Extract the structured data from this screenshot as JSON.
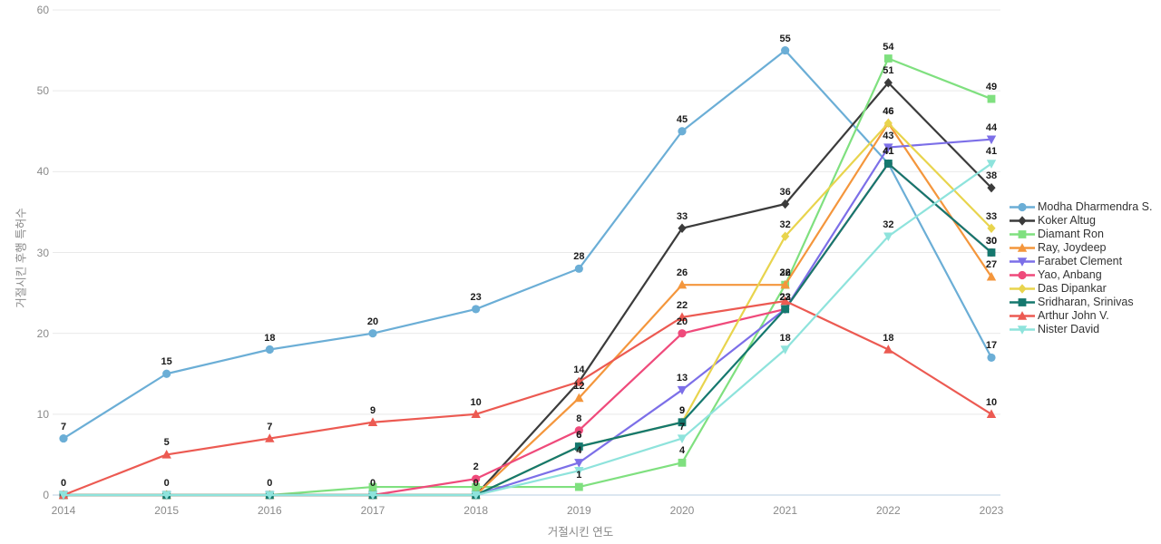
{
  "chart_data": {
    "type": "line",
    "title": "",
    "xlabel": "거절시킨 연도",
    "ylabel": "거절시킨 후행 특허수",
    "categories": [
      "2014",
      "2015",
      "2016",
      "2017",
      "2018",
      "2019",
      "2020",
      "2021",
      "2022",
      "2023"
    ],
    "ylim": [
      0,
      60
    ],
    "yticks": [
      0,
      10,
      20,
      30,
      40,
      50,
      60
    ],
    "grid": true,
    "legend_position": "right",
    "series": [
      {
        "name": "Modha Dharmendra S.",
        "color": "#6BAED6",
        "marker": "circle",
        "values": [
          7,
          15,
          18,
          20,
          23,
          28,
          45,
          55,
          41,
          17
        ]
      },
      {
        "name": "Koker Altug",
        "color": "#3B3B3B",
        "marker": "diamond",
        "values": [
          0,
          0,
          0,
          0,
          0,
          14,
          33,
          36,
          51,
          38
        ]
      },
      {
        "name": "Diamant Ron",
        "color": "#7FE07F",
        "marker": "square",
        "values": [
          0,
          0,
          0,
          1,
          1,
          1,
          4,
          26,
          54,
          49
        ]
      },
      {
        "name": "Ray, Joydeep",
        "color": "#F4963C",
        "marker": "triangle-up",
        "values": [
          0,
          0,
          0,
          0,
          0,
          12,
          26,
          26,
          46,
          27
        ]
      },
      {
        "name": "Farabet Clement",
        "color": "#7C6FE8",
        "marker": "triangle-down",
        "values": [
          0,
          0,
          0,
          0,
          0,
          4,
          13,
          23,
          43,
          44
        ]
      },
      {
        "name": "Yao, Anbang",
        "color": "#EF4A7B",
        "marker": "circle",
        "values": [
          0,
          0,
          0,
          0,
          2,
          8,
          20,
          23,
          41,
          30
        ]
      },
      {
        "name": "Das Dipankar",
        "color": "#E8D44D",
        "marker": "diamond",
        "values": [
          0,
          0,
          0,
          0,
          0,
          6,
          9,
          32,
          46,
          33
        ]
      },
      {
        "name": "Sridharan, Srinivas",
        "color": "#15786E",
        "marker": "square",
        "values": [
          0,
          0,
          0,
          0,
          0,
          6,
          9,
          23,
          41,
          30
        ]
      },
      {
        "name": "Arthur John V.",
        "color": "#EC5A52",
        "marker": "triangle-up",
        "values": [
          0,
          5,
          7,
          9,
          10,
          14,
          22,
          24,
          18,
          10
        ]
      },
      {
        "name": "Nister David",
        "color": "#8EE3DC",
        "marker": "triangle-down",
        "values": [
          0,
          0,
          0,
          0,
          0,
          3,
          7,
          18,
          32,
          41
        ]
      }
    ],
    "point_labels": [
      {
        "series": "Modha Dharmendra S.",
        "x": "2014",
        "text": "7"
      },
      {
        "series": "Modha Dharmendra S.",
        "x": "2015",
        "text": "15"
      },
      {
        "series": "Modha Dharmendra S.",
        "x": "2016",
        "text": "18"
      },
      {
        "series": "Modha Dharmendra S.",
        "x": "2017",
        "text": "20"
      },
      {
        "series": "Modha Dharmendra S.",
        "x": "2018",
        "text": "23"
      },
      {
        "series": "Modha Dharmendra S.",
        "x": "2019",
        "text": "28"
      },
      {
        "series": "Modha Dharmendra S.",
        "x": "2020",
        "text": "45"
      },
      {
        "series": "Modha Dharmendra S.",
        "x": "2021",
        "text": "55"
      },
      {
        "series": "Modha Dharmendra S.",
        "x": "2022",
        "text": "41"
      },
      {
        "series": "Modha Dharmendra S.",
        "x": "2023",
        "text": "17"
      },
      {
        "series": "Koker Altug",
        "x": "2019",
        "text": "14"
      },
      {
        "series": "Koker Altug",
        "x": "2020",
        "text": "33"
      },
      {
        "series": "Koker Altug",
        "x": "2021",
        "text": "36"
      },
      {
        "series": "Koker Altug",
        "x": "2022",
        "text": "51"
      },
      {
        "series": "Koker Altug",
        "x": "2023",
        "text": "38"
      },
      {
        "series": "Diamant Ron",
        "x": "2019",
        "text": "1"
      },
      {
        "series": "Diamant Ron",
        "x": "2020",
        "text": "4"
      },
      {
        "series": "Diamant Ron",
        "x": "2021",
        "text": "26"
      },
      {
        "series": "Diamant Ron",
        "x": "2022",
        "text": "54"
      },
      {
        "series": "Diamant Ron",
        "x": "2023",
        "text": "49"
      },
      {
        "series": "Ray, Joydeep",
        "x": "2019",
        "text": "12"
      },
      {
        "series": "Ray, Joydeep",
        "x": "2020",
        "text": "26"
      },
      {
        "series": "Ray, Joydeep",
        "x": "2021",
        "text": "32"
      },
      {
        "series": "Ray, Joydeep",
        "x": "2022",
        "text": "46"
      },
      {
        "series": "Ray, Joydeep",
        "x": "2023",
        "text": "27"
      },
      {
        "series": "Farabet Clement",
        "x": "2019",
        "text": "4"
      },
      {
        "series": "Farabet Clement",
        "x": "2020",
        "text": "13"
      },
      {
        "series": "Farabet Clement",
        "x": "2021",
        "text": "23"
      },
      {
        "series": "Farabet Clement",
        "x": "2022",
        "text": "43"
      },
      {
        "series": "Farabet Clement",
        "x": "2023",
        "text": "44"
      },
      {
        "series": "Yao, Anbang",
        "x": "2018",
        "text": "2"
      },
      {
        "series": "Yao, Anbang",
        "x": "2019",
        "text": "8"
      },
      {
        "series": "Yao, Anbang",
        "x": "2020",
        "text": "20"
      },
      {
        "series": "Yao, Anbang",
        "x": "2021",
        "text": "23"
      },
      {
        "series": "Yao, Anbang",
        "x": "2022",
        "text": "41"
      },
      {
        "series": "Yao, Anbang",
        "x": "2023",
        "text": "30"
      },
      {
        "series": "Das Dipankar",
        "x": "2019",
        "text": "6"
      },
      {
        "series": "Das Dipankar",
        "x": "2020",
        "text": "9"
      },
      {
        "series": "Das Dipankar",
        "x": "2021",
        "text": "32"
      },
      {
        "series": "Das Dipankar",
        "x": "2022",
        "text": "46"
      },
      {
        "series": "Das Dipankar",
        "x": "2023",
        "text": "33"
      },
      {
        "series": "Sridharan, Srinivas",
        "x": "2019",
        "text": "6"
      },
      {
        "series": "Sridharan, Srinivas",
        "x": "2020",
        "text": "9"
      },
      {
        "series": "Sridharan, Srinivas",
        "x": "2021",
        "text": "22"
      },
      {
        "series": "Sridharan, Srinivas",
        "x": "2022",
        "text": "41"
      },
      {
        "series": "Sridharan, Srinivas",
        "x": "2023",
        "text": "30"
      },
      {
        "series": "Arthur John V.",
        "x": "2014",
        "text": "0"
      },
      {
        "series": "Arthur John V.",
        "x": "2015",
        "text": "5"
      },
      {
        "series": "Arthur John V.",
        "x": "2016",
        "text": "7"
      },
      {
        "series": "Arthur John V.",
        "x": "2017",
        "text": "9"
      },
      {
        "series": "Arthur John V.",
        "x": "2018",
        "text": "10"
      },
      {
        "series": "Arthur John V.",
        "x": "2020",
        "text": "22"
      },
      {
        "series": "Arthur John V.",
        "x": "2022",
        "text": "18"
      },
      {
        "series": "Arthur John V.",
        "x": "2023",
        "text": "10"
      },
      {
        "series": "Nister David",
        "x": "2018",
        "text": "0"
      },
      {
        "series": "Nister David",
        "x": "2020",
        "text": "7"
      },
      {
        "series": "Nister David",
        "x": "2021",
        "text": "18"
      },
      {
        "series": "Nister David",
        "x": "2022",
        "text": "32"
      },
      {
        "series": "Nister David",
        "x": "2023",
        "text": "41"
      },
      {
        "series": "Nister David",
        "x": "2015",
        "text": "0"
      },
      {
        "series": "Nister David",
        "x": "2016",
        "text": "0"
      },
      {
        "series": "Nister David",
        "x": "2017",
        "text": "0"
      }
    ]
  }
}
